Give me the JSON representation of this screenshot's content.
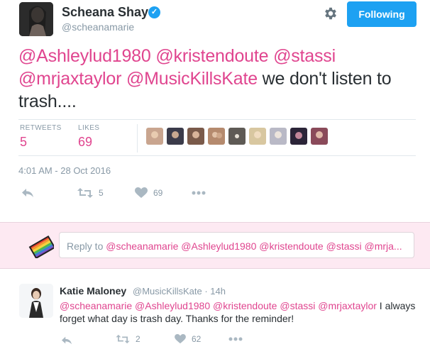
{
  "profile": {
    "name": "Scheana Shay",
    "handle": "@scheanamarie",
    "follow_button": "Following"
  },
  "tweet": {
    "text_segments": [
      {
        "text": "@Ashleylud1980",
        "type": "mention"
      },
      {
        "text": " ",
        "type": "text"
      },
      {
        "text": "@kristendoute",
        "type": "mention"
      },
      {
        "text": " ",
        "type": "text"
      },
      {
        "text": "@stassi",
        "type": "mention"
      },
      {
        "text": " ",
        "type": "text"
      },
      {
        "text": "@mrjaxtaylor",
        "type": "mention"
      },
      {
        "text": " ",
        "type": "text"
      },
      {
        "text": "@MusicKillsKate",
        "type": "mention"
      },
      {
        "text": " we don't listen to trash....",
        "type": "text"
      }
    ],
    "stats": {
      "retweets_label": "RETWEETS",
      "retweets_value": "5",
      "likes_label": "LIKES",
      "likes_value": "69"
    },
    "timestamp": "4:01 AM - 28 Oct 2016",
    "actions": {
      "retweet_count": "5",
      "like_count": "69"
    }
  },
  "liker_colors": [
    "#c9a58f",
    "#3b3b4a",
    "#7a5a4a",
    "#b58a6e",
    "#5e5a55",
    "#d8c7a0",
    "#b9b9c6",
    "#2b2438",
    "#8a4a5a"
  ],
  "reply_box": {
    "prefix": "Reply to ",
    "mentions": "@scheanamarie @Ashleylud1980 @kristendoute @stassi @mrja..."
  },
  "reply": {
    "name": "Katie Maloney",
    "handle": "@MusicKillsKate · 14h",
    "mentions": "@scheanamarie @Ashleylud1980 @kristendoute @stassi @mrjaxtaylor",
    "text": " I always forget what day is trash day. Thanks for the reminder!",
    "retweet_count": "2",
    "like_count": "62"
  },
  "colors": {
    "accent": "#1da1f2",
    "mention": "#e0458f",
    "muted": "#8899a6",
    "reply_bg": "#fde9f2"
  },
  "icons": [
    "verified-badge-icon",
    "gear-icon",
    "reply-icon",
    "retweet-icon",
    "heart-icon",
    "more-icon",
    "rainbow-logo-icon"
  ]
}
